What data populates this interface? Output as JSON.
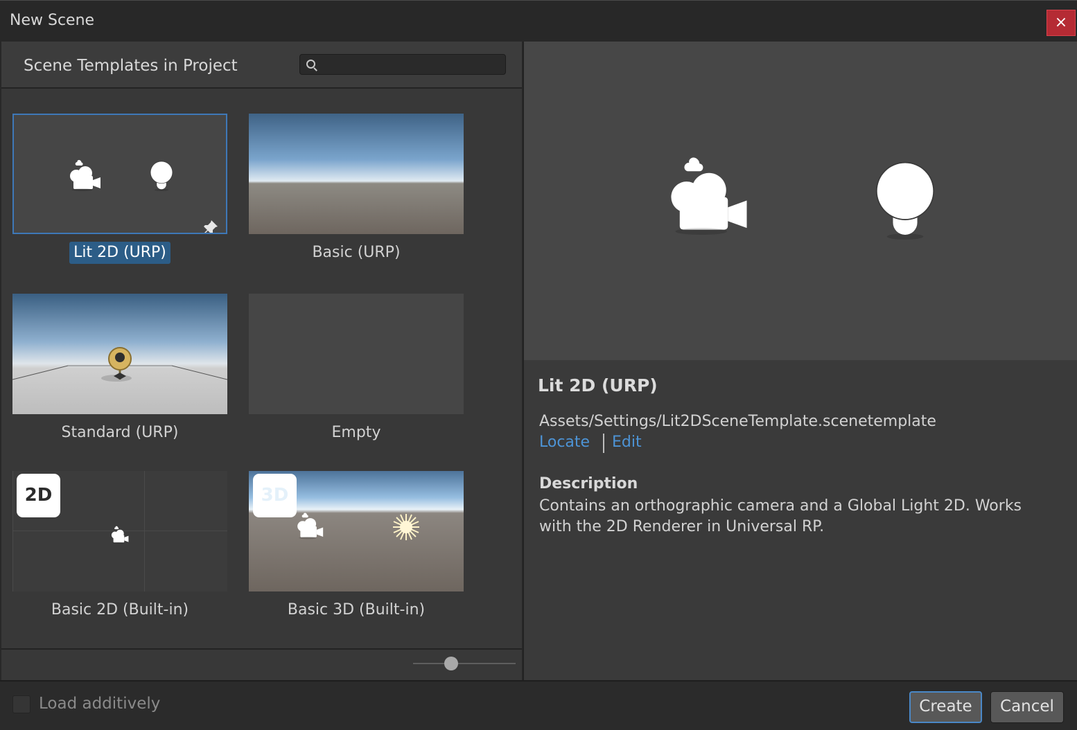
{
  "window": {
    "title": "New Scene",
    "close_label": "×"
  },
  "left_panel": {
    "title": "Scene Templates in Project",
    "search": {
      "value": "",
      "placeholder": ""
    },
    "templates": [
      {
        "label": "Lit 2D (URP)",
        "selected": true,
        "pinned": true
      },
      {
        "label": "Basic (URP)",
        "selected": false
      },
      {
        "label": "Standard (URP)",
        "selected": false
      },
      {
        "label": "Empty",
        "selected": false
      },
      {
        "label": "Basic 2D (Built-in)",
        "selected": false,
        "badge": "2D"
      },
      {
        "label": "Basic 3D (Built-in)",
        "selected": false,
        "badge": "3D"
      }
    ],
    "thumbnail_size_slider": {
      "value": 0.37
    }
  },
  "details": {
    "title": "Lit 2D (URP)",
    "path": "Assets/Settings/Lit2DSceneTemplate.scenetemplate",
    "locate_label": "Locate",
    "edit_label": "Edit",
    "description_heading": "Description",
    "description": "Contains an orthographic camera and a Global Light 2D. Works with the 2D Renderer in Universal RP."
  },
  "footer": {
    "load_additively_label": "Load additively",
    "load_additively_checked": false,
    "create_label": "Create",
    "cancel_label": "Cancel"
  },
  "colors": {
    "accent": "#3e78b8",
    "selection": "#2c5d87",
    "link": "#4d94d6",
    "close": "#b52b34"
  },
  "icons": [
    "search-icon",
    "pin-icon",
    "camera-icon",
    "light-bulb-icon",
    "sun-icon",
    "gizmo-icon"
  ]
}
